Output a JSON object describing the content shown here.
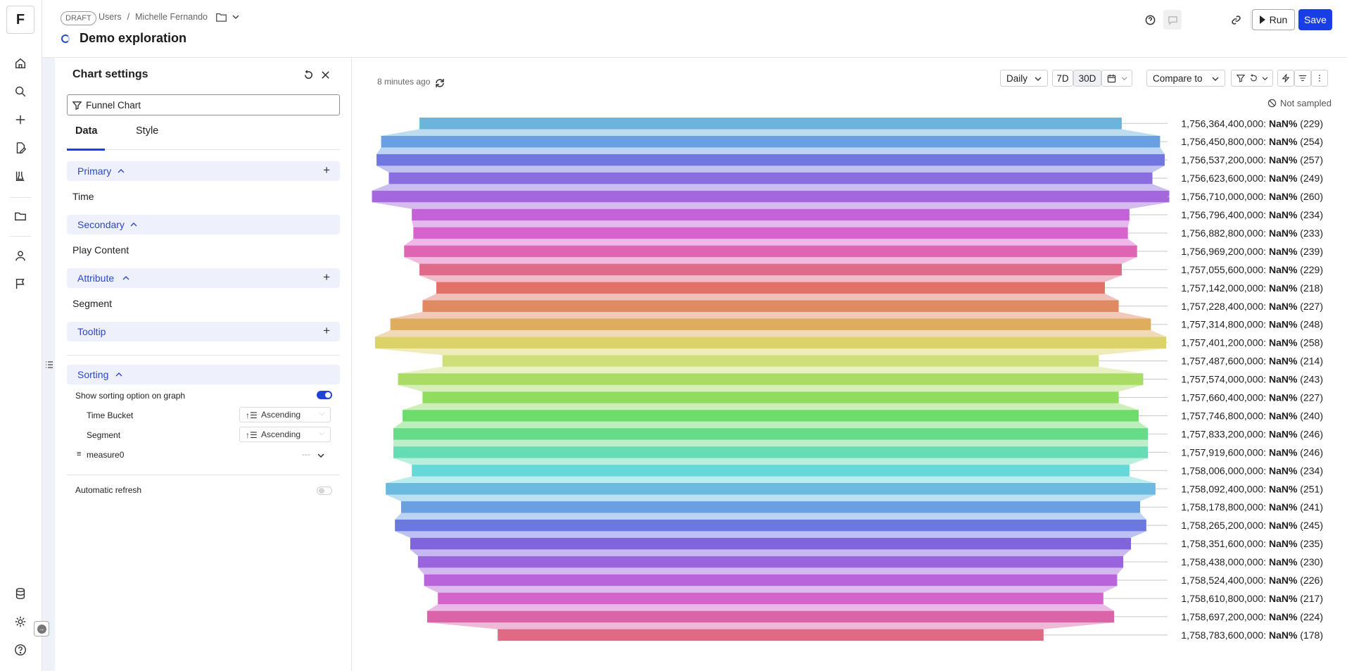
{
  "rail": {
    "logo": "F",
    "icons": [
      "home-icon",
      "search-icon",
      "plus-icon",
      "file-edit-icon",
      "flask-icon",
      "folder-icon",
      "user-icon",
      "flag-icon",
      "database-icon",
      "gear-icon",
      "help-icon"
    ]
  },
  "header": {
    "badge": "DRAFT",
    "breadcrumb_users": "Users",
    "breadcrumb_sep": "/",
    "breadcrumb_owner": "Michelle Fernando",
    "title": "Demo exploration",
    "run_label": "Run",
    "save_label": "Save",
    "accent": "#1a3ee6"
  },
  "panel": {
    "title": "Chart settings",
    "chart_type": "Funnel Chart",
    "tabs": [
      {
        "label": "Data"
      },
      {
        "label": "Style"
      }
    ],
    "sections": {
      "primary": "Primary",
      "primary_item": "Time",
      "secondary": "Secondary",
      "secondary_item": "Play Content",
      "attribute": "Attribute",
      "attribute_item": "Segment",
      "tooltip": "Tooltip",
      "sorting": "Sorting"
    },
    "sorting": {
      "show_option": "Show sorting option on graph",
      "time_bucket": "Time Bucket",
      "time_bucket_value": "Ascending",
      "segment": "Segment",
      "segment_value": "Ascending",
      "measure": "measure0",
      "measure_value": "---"
    },
    "auto_refresh": "Automatic refresh"
  },
  "toolbar": {
    "updated": "8 minutes ago",
    "granularity": "Daily",
    "range_7d": "7D",
    "range_30d": "30D",
    "compare": "Compare to",
    "sampling": "Not sampled"
  },
  "chart_data": {
    "type": "funnel",
    "value_label": "NaN%",
    "colors": [
      "#6cb4dc",
      "#6a9fe2",
      "#7176e0",
      "#8a6ee0",
      "#a467de",
      "#c463d8",
      "#d963cc",
      "#de64b4",
      "#df6a8a",
      "#e07268",
      "#e08a64",
      "#dfad5e",
      "#dbd368",
      "#cfe07a",
      "#a8dc64",
      "#8fdc5e",
      "#6cdc6a",
      "#66dc88",
      "#66dcb4",
      "#66d8d8",
      "#6cbadf",
      "#6aa0e2",
      "#6a78e0",
      "#8064de",
      "#9a64de",
      "#b964da",
      "#d364cc",
      "#db64a8",
      "#df6a84"
    ],
    "steps": [
      {
        "label": "1,756,364,400,000",
        "count": 229
      },
      {
        "label": "1,756,450,800,000",
        "count": 254
      },
      {
        "label": "1,756,537,200,000",
        "count": 257
      },
      {
        "label": "1,756,623,600,000",
        "count": 249
      },
      {
        "label": "1,756,710,000,000",
        "count": 260
      },
      {
        "label": "1,756,796,400,000",
        "count": 234
      },
      {
        "label": "1,756,882,800,000",
        "count": 233
      },
      {
        "label": "1,756,969,200,000",
        "count": 239
      },
      {
        "label": "1,757,055,600,000",
        "count": 229
      },
      {
        "label": "1,757,142,000,000",
        "count": 218
      },
      {
        "label": "1,757,228,400,000",
        "count": 227
      },
      {
        "label": "1,757,314,800,000",
        "count": 248
      },
      {
        "label": "1,757,401,200,000",
        "count": 258
      },
      {
        "label": "1,757,487,600,000",
        "count": 214
      },
      {
        "label": "1,757,574,000,000",
        "count": 243
      },
      {
        "label": "1,757,660,400,000",
        "count": 227
      },
      {
        "label": "1,757,746,800,000",
        "count": 240
      },
      {
        "label": "1,757,833,200,000",
        "count": 246
      },
      {
        "label": "1,757,919,600,000",
        "count": 246
      },
      {
        "label": "1,758,006,000,000",
        "count": 234
      },
      {
        "label": "1,758,092,400,000",
        "count": 251
      },
      {
        "label": "1,758,178,800,000",
        "count": 241
      },
      {
        "label": "1,758,265,200,000",
        "count": 245
      },
      {
        "label": "1,758,351,600,000",
        "count": 235
      },
      {
        "label": "1,758,438,000,000",
        "count": 230
      },
      {
        "label": "1,758,524,400,000",
        "count": 226
      },
      {
        "label": "1,758,610,800,000",
        "count": 217
      },
      {
        "label": "1,758,697,200,000",
        "count": 224
      },
      {
        "label": "1,758,783,600,000",
        "count": 178
      }
    ]
  }
}
